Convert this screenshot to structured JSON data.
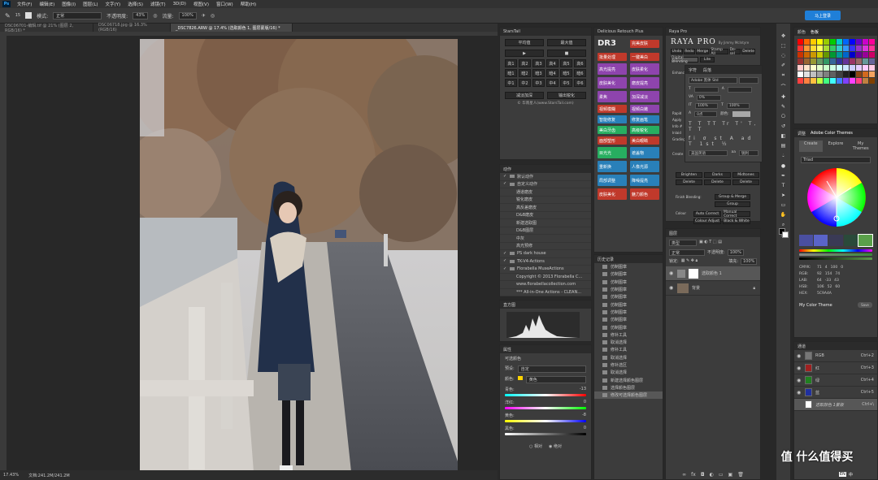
{
  "app": {
    "logo": "Ps"
  },
  "menu": [
    "文件(F)",
    "编辑(E)",
    "图像(I)",
    "图层(L)",
    "文字(Y)",
    "选择(S)",
    "滤镜(T)",
    "3D(D)",
    "视图(V)",
    "窗口(W)",
    "帮助(H)"
  ],
  "options": {
    "mode_label": "模式:",
    "mode_value": "正常",
    "opacity_label": "不透明度:",
    "opacity_value": "43%",
    "flow_label": "流量:",
    "flow_value": "100%",
    "brush_size": "15",
    "cloud_btn": "马上登录"
  },
  "tabs": [
    "DSC06701-编辑.tif @ 21% (图层 2, RGB/16) *",
    "DSC06718.jpg @ 16.3%(RGB/16)",
    "_DSC7826.ARW @ 17.4% (选取颜色 1, 图层蒙版/16) *"
  ],
  "status": {
    "zoom": "17.43%",
    "doc": "文档:241.2M/241.2M"
  },
  "startail": {
    "title": "StarsTail",
    "top_btns": [
      "平均值",
      "最大值"
    ],
    "rows": [
      [
        "高1",
        "高2",
        "高3",
        "高4",
        "高5",
        "高6"
      ],
      [
        "暗1",
        "暗2",
        "暗3",
        "暗4",
        "暗5",
        "暗6"
      ],
      [
        "中1",
        "中2",
        "中3",
        "中4",
        "中5",
        "中6"
      ]
    ],
    "bottom_btns": [
      "减淡加深",
      "输出锐化"
    ],
    "credit": "© 华南星人(www.StarsTail.com)"
  },
  "actions": {
    "title": "动作",
    "rows": [
      "默认动作",
      "自定义动作",
      "通道磨皮",
      "锐化磨皮",
      "高反差磨皮",
      "D&B磨皮",
      "新建选取图",
      "D&B图层",
      "中灰",
      "高光预修",
      "PS dark house",
      "TK-V4-Actions",
      "Florabella MuseActions",
      "Copyright © 2013 Florabella C...",
      "www.florabellacollection.com",
      "*** All-in-One Actions - CLEAN..."
    ]
  },
  "histogram": {
    "title": "直方图"
  },
  "properties": {
    "title": "属性",
    "adj": "可选颜色",
    "preset_label": "预设:",
    "preset_value": "自定",
    "color_label": "颜色:",
    "color_value": "黄色",
    "sliders": [
      {
        "label": "青色:",
        "value": "-13",
        "pct": "%"
      },
      {
        "label": "洋红:",
        "value": "0",
        "pct": "%"
      },
      {
        "label": "黄色:",
        "value": "-8",
        "pct": "%"
      },
      {
        "label": "黑色:",
        "value": "0",
        "pct": "%"
      }
    ],
    "radio1": "相对",
    "radio2": "绝对"
  },
  "delicious": {
    "title": "Delicious Retouch Plus",
    "logo": "DR3",
    "right_btn": "完美皮肤",
    "buttons": [
      [
        "批量处理",
        "一键美白"
      ],
      [
        "高光提亮",
        "皮肤柔化"
      ],
      [
        "皮肤美化",
        "磨皮提亮"
      ],
      [
        "柔焦",
        "加深减淡"
      ],
      [
        "视频模糊",
        "视频白嫩"
      ],
      [
        "智能修复",
        "修复画笔"
      ],
      [
        "美白牙齿",
        "高级锐化"
      ],
      [
        "面部塑形",
        "美白眼睛"
      ],
      [
        "目光光",
        "遮盖物"
      ],
      [
        "重新换",
        "人像光源"
      ],
      [
        "局部调整",
        "降噪提亮"
      ],
      [
        "皮肤美化",
        "魅力颜色"
      ]
    ]
  },
  "history": {
    "title": "历史记录",
    "rows": [
      "仿制图章",
      "仿制图章",
      "仿制图章",
      "仿制图章",
      "仿制图章",
      "仿制图章",
      "仿制图章",
      "仿制图章",
      "仿制图章",
      "修补工具",
      "取消选择",
      "修补工具",
      "取消选择",
      "修补选区",
      "取消选择",
      "新建选择颜色图层",
      "选择颜色图层",
      "修改可选择颜色图层"
    ]
  },
  "raya": {
    "title": "Raya Pro",
    "logo": "RAYA PRO",
    "byline": "By Jimmy McIntyre",
    "top_btns": [
      "Undo",
      "Redo",
      "Merge",
      "Stamp All",
      "De-sel",
      "Delete"
    ],
    "tabs": [
      "Digital Blending",
      "Lite"
    ],
    "side_labels": [
      "Enhance",
      "Rapid",
      "Apply",
      "Info #",
      "Inlaid",
      "Grading",
      "Create"
    ],
    "blend_label": "Finish Blending:",
    "colour_label": "Colour",
    "buttons": [
      "Brighten",
      "Darks",
      "Midtones",
      "Delete",
      "Delete",
      "Delete",
      "Group & Merge",
      "Group",
      "Auto Correct",
      "Manual Correct",
      "Colour Adjust",
      "Black & White"
    ]
  },
  "character": {
    "tabs": [
      "字符",
      "段落"
    ],
    "font": "Adobe 黑体 Std",
    "style": "",
    "size": "",
    "tracking": "0%",
    "scale1": "100%",
    "scale2": "100%",
    "baseline": "0点",
    "color_label": "颜色:",
    "lang": "美国英语",
    "aa": "锐利"
  },
  "layers": {
    "title": "图层",
    "kind": "类型",
    "mode": "正常",
    "opacity_label": "不透明度:",
    "opacity": "100%",
    "lock_label": "锁定:",
    "fill_label": "填充:",
    "fill": "100%",
    "rows": [
      "选取颜色 1",
      "背景"
    ]
  },
  "color": {
    "tabs": [
      "颜色",
      "色板"
    ],
    "swatch_colors": [
      "#ff0000",
      "#ff6600",
      "#ffcc00",
      "#ffff00",
      "#99cc00",
      "#00cc00",
      "#00cccc",
      "#0066ff",
      "#0000ff",
      "#6600cc",
      "#cc00cc",
      "#ff0099",
      "#ff3333",
      "#ff9933",
      "#ffdd33",
      "#ffff66",
      "#aadd33",
      "#33cc66",
      "#33cccc",
      "#3399ff",
      "#3333ff",
      "#9933cc",
      "#dd33dd",
      "#ff3399",
      "#cc3300",
      "#cc6600",
      "#cc9900",
      "#cccc00",
      "#669900",
      "#009933",
      "#009999",
      "#0066cc",
      "#0000cc",
      "#660099",
      "#990099",
      "#cc0066",
      "#993333",
      "#996633",
      "#999933",
      "#669966",
      "#339966",
      "#336699",
      "#333399",
      "#663399",
      "#993366",
      "#996666",
      "#669999",
      "#666699",
      "#ffcccc",
      "#ffe5cc",
      "#ffffcc",
      "#e5ffcc",
      "#ccffcc",
      "#ccffe5",
      "#ccffff",
      "#cce5ff",
      "#ccccff",
      "#e5ccff",
      "#ffccff",
      "#ffcce5",
      "#ffffff",
      "#e0e0e0",
      "#c0c0c0",
      "#a0a0a0",
      "#808080",
      "#606060",
      "#404040",
      "#202020",
      "#000000",
      "#8b4513",
      "#d2691e",
      "#f4a460",
      "#ff4040",
      "#ff8040",
      "#ffc040",
      "#c0ff40",
      "#40ff80",
      "#40ffff",
      "#4080ff",
      "#8040ff",
      "#ff40ff",
      "#ff4080",
      "#c08040",
      "#804000"
    ]
  },
  "adobe_color": {
    "tabs": [
      "调整",
      "Adobe Color Themes"
    ],
    "subtabs": [
      "Create",
      "Explore",
      "My Themes"
    ],
    "rule": "Triad",
    "theme_colors": [
      "#4a4fa0",
      "#5a64c8",
      "#3a3a55",
      "#2a4a3a",
      "#5aa04a"
    ],
    "values": [
      {
        "l": "CMYK:",
        "v": [
          "71",
          "4",
          "100",
          "0"
        ]
      },
      {
        "l": "RGB:",
        "v": [
          "92",
          "154",
          "74"
        ]
      },
      {
        "l": "LAB:",
        "v": [
          "64",
          "-33",
          "43"
        ]
      },
      {
        "l": "HSB:",
        "v": [
          "106",
          "52",
          "60"
        ]
      },
      {
        "l": "HEX:",
        "v": [
          "5C9A4A"
        ]
      }
    ],
    "theme_name": "My Color Theme",
    "save": "Save"
  },
  "channels": {
    "title": "通道",
    "rows": [
      {
        "name": "RGB",
        "key": "Ctrl+2",
        "color": "#777"
      },
      {
        "name": "红",
        "key": "Ctrl+3",
        "color": "#a02020"
      },
      {
        "name": "绿",
        "key": "Ctrl+4",
        "color": "#208020"
      },
      {
        "name": "蓝",
        "key": "Ctrl+5",
        "color": "#2030a0"
      },
      {
        "name": "选取颜色 1蒙版",
        "key": "Ctrl+\\",
        "color": "#fff"
      }
    ]
  },
  "taskbar": {
    "lang": "EN",
    "ime": "中",
    "site": "值 什么值得买"
  }
}
